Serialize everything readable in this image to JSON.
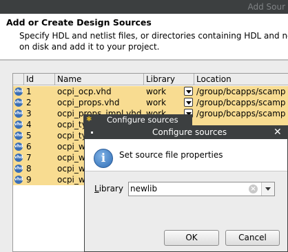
{
  "window": {
    "title": "Add Sour"
  },
  "header": {
    "title": "Add or Create Design Sources",
    "desc_line1": "Specify HDL and netlist files, or directories containing HDL and netli",
    "desc_line2": "on disk and add it to your project."
  },
  "table": {
    "columns": [
      "",
      "Id",
      "Name",
      "Library",
      "Location"
    ],
    "rows": [
      {
        "icon": "vhd",
        "id": "1",
        "name": "ocpi_ocp.vhd",
        "library": "work",
        "location": "/group/bcapps/scamp"
      },
      {
        "icon": "vhd",
        "id": "2",
        "name": "ocpi_props.vhd",
        "library": "work",
        "location": "/group/bcapps/scamp"
      },
      {
        "icon": "vhd",
        "id": "3",
        "name": "ocpi_props_impl.vhd",
        "library": "work",
        "location": "/group/bcapps/scamp"
      },
      {
        "icon": "vhd",
        "id": "4",
        "name": "ocpi_ty",
        "library": "",
        "location": ""
      },
      {
        "icon": "vhd",
        "id": "5",
        "name": "ocpi_ty",
        "library": "",
        "location": ""
      },
      {
        "icon": "vhd",
        "id": "6",
        "name": "ocpi_w",
        "library": "",
        "location": ""
      },
      {
        "icon": "vhd",
        "id": "7",
        "name": "ocpi_w",
        "library": "",
        "location": ""
      },
      {
        "icon": "vhd",
        "id": "8",
        "name": "ocpi_w",
        "library": "",
        "location": ""
      },
      {
        "icon": "vhd",
        "id": "9",
        "name": "ocpi_w",
        "library": "",
        "location": ""
      }
    ]
  },
  "back_dialog": {
    "title": "Configure sources"
  },
  "dialog": {
    "title": "Configure sources",
    "close": "✕",
    "message": "Set source file properties",
    "library_label_pre": "",
    "library_label_u": "L",
    "library_label_post": "ibrary",
    "library_value": "newlib",
    "ok": "OK",
    "cancel": "Cancel"
  },
  "colors": {
    "row_highlight": "#f8dc91",
    "titlebar": "#3c3f40"
  }
}
